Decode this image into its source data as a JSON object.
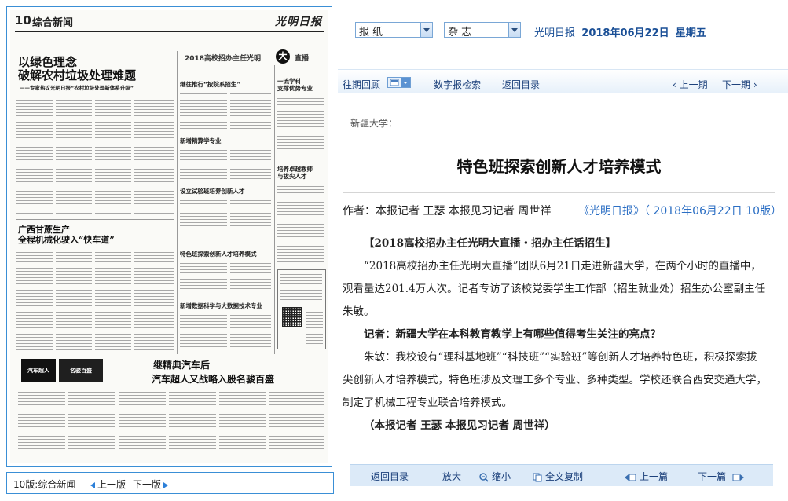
{
  "left_page": {
    "page_number": "10",
    "section": "综合新闻",
    "masthead": "光明日报",
    "headline_main": "以绿色理念\n破解农村垃圾处理难题",
    "headline_sub": "——专家热议光明日报“农村垃圾处理新体系升级”",
    "headline_2": "广西甘蔗生产\n全程机械化驶入“快车道”",
    "banner_title": "2018高校招办主任光明",
    "banner_da": "大",
    "banner_tail": "直播",
    "side_items": [
      "继往推行“按院系招生”",
      "新增精算学专业",
      "设立试验班培养创新人才",
      "特色班探索创新人才培养模式",
      "新增数据科学与大数据技术专业"
    ],
    "side_items_right": [
      "一流学科\n支撑优势专业",
      "培养卓越教师\n与拔尖人才"
    ],
    "ad_logo_1": "汽车超人",
    "ad_logo_2": "名骏百盛",
    "ad_title_1": "继精典汽车后",
    "ad_title_2": "汽车超人又战略入股名骏百盛"
  },
  "left_bar": {
    "label": "10版:综合新闻",
    "prev": "上一版",
    "next": "下一版"
  },
  "selectors": {
    "newspaper": "报 纸",
    "magazine": "杂 志"
  },
  "paper_info": {
    "name": "光明日报",
    "date": "2018年06月22日",
    "weekday": "星期五"
  },
  "toolbar": {
    "past_review": "往期回顾",
    "digital_search": "数字报检索",
    "back_to_index": "返回目录",
    "prev_issue": "上一期",
    "next_issue": "下一期"
  },
  "article": {
    "pre_title": "新疆大学：",
    "title": "特色班探索创新人才培养模式",
    "author": "作者：本报记者 王瑟 本报见习记者 周世祥",
    "source": "《光明日报》（ 2018年06月22日 10版）",
    "paragraphs": [
      "【2018高校招办主任光明大直播・招办主任话招生】",
      "“2018高校招办主任光明大直播”团队6月21日走进新疆大学，在两个小时的直播中，观看量达201.4万人次。记者专访了该校党委学生工作部（招生就业处）招生办公室副主任朱敏。",
      "记者：新疆大学在本科教育教学上有哪些值得考生关注的亮点？",
      "朱敏：我校设有“理科基地班”“科技班”“实验班”等创新人才培养特色班，积极探索拔尖创新人才培养模式，特色班涉及文理工多个专业、多种类型。学校还联合西安交通大学，制定了机械工程专业联合培养模式。",
      "（本报记者 王瑟 本报见习记者 周世祥）"
    ]
  },
  "bottom_bar": {
    "back_to_index": "返回目录",
    "zoom_in": "放大",
    "zoom_out": "缩小",
    "copy_all": "全文复制",
    "prev_article": "上一篇",
    "next_article": "下一篇"
  },
  "colors": {
    "link_blue": "#1a3f7a",
    "frame_blue": "#3a8fd6",
    "source_blue": "#2c6fc4"
  }
}
